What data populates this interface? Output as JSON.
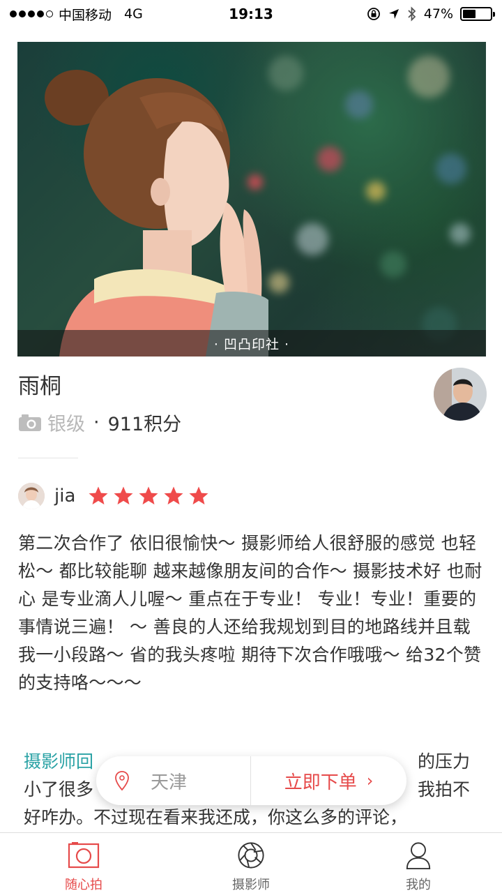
{
  "status_bar": {
    "carrier": "中国移动",
    "network": "4G",
    "time": "19:13",
    "battery_percent": "47%",
    "battery_level": 0.47
  },
  "hero": {
    "caption": "· 凹凸印社 ·"
  },
  "profile": {
    "name": "雨桐",
    "level": "银级",
    "separator": "·",
    "points": "911积分"
  },
  "review": {
    "reviewer_name": "jia",
    "rating": 5,
    "text": "第二次合作了 依旧很愉快～ 摄影师给人很舒服的感觉 也轻松～ 都比较能聊 越来越像朋友间的合作～ 摄影技术好 也耐心 是专业滴人儿喔～ 重点在于专业！ 专业！专业！重要的事情说三遍！ ～ 善良的人还给我规划到目的地路线并且载我一小段路～ 省的我头疼啦 期待下次合作哦哦～ 给32个赞的支持咯～～～"
  },
  "reply": {
    "label": "摄影师回",
    "line1_tail": "的压力",
    "line2_head": "小了很多",
    "line2_tail": "我拍不",
    "line3": "好咋办。不过现在看来我还成，你这么多的评论，"
  },
  "floating_bar": {
    "city": "天津",
    "order_label": "立即下单",
    "chevron": "›"
  },
  "tabs": [
    {
      "label": "随心拍",
      "icon": "camera-icon",
      "active": true
    },
    {
      "label": "摄影师",
      "icon": "aperture-icon",
      "active": false
    },
    {
      "label": "我的",
      "icon": "user-icon",
      "active": false
    }
  ],
  "colors": {
    "accent_red": "#e64a4a",
    "reply_teal": "#2aa2a5",
    "star": "#ef4b4b"
  }
}
